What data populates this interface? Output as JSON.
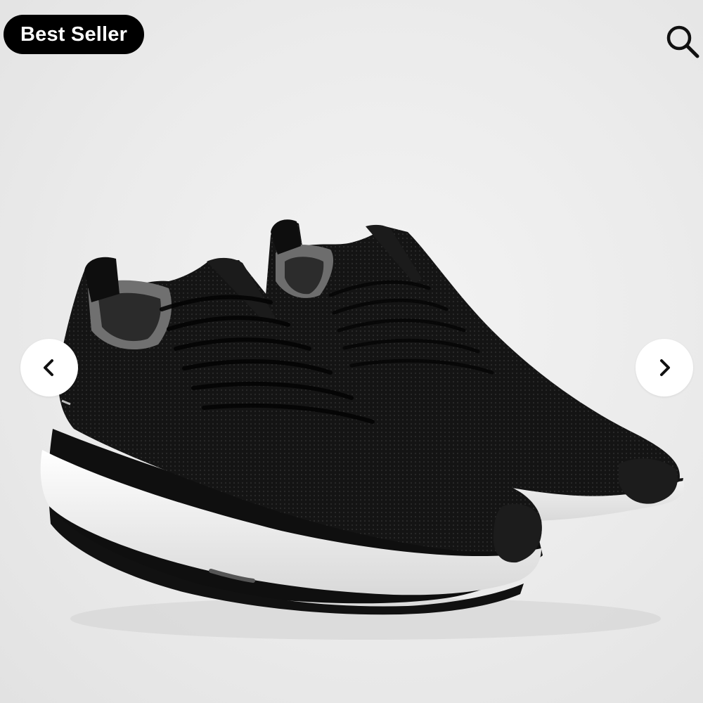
{
  "badge": {
    "label": "Best Seller"
  },
  "icons": {
    "search": "search-icon",
    "prev": "chevron-left-icon",
    "next": "chevron-right-icon"
  },
  "colors": {
    "badge_bg": "#000000",
    "badge_text": "#ffffff",
    "nav_button_bg": "#ffffff",
    "background": "#ebebeb"
  }
}
